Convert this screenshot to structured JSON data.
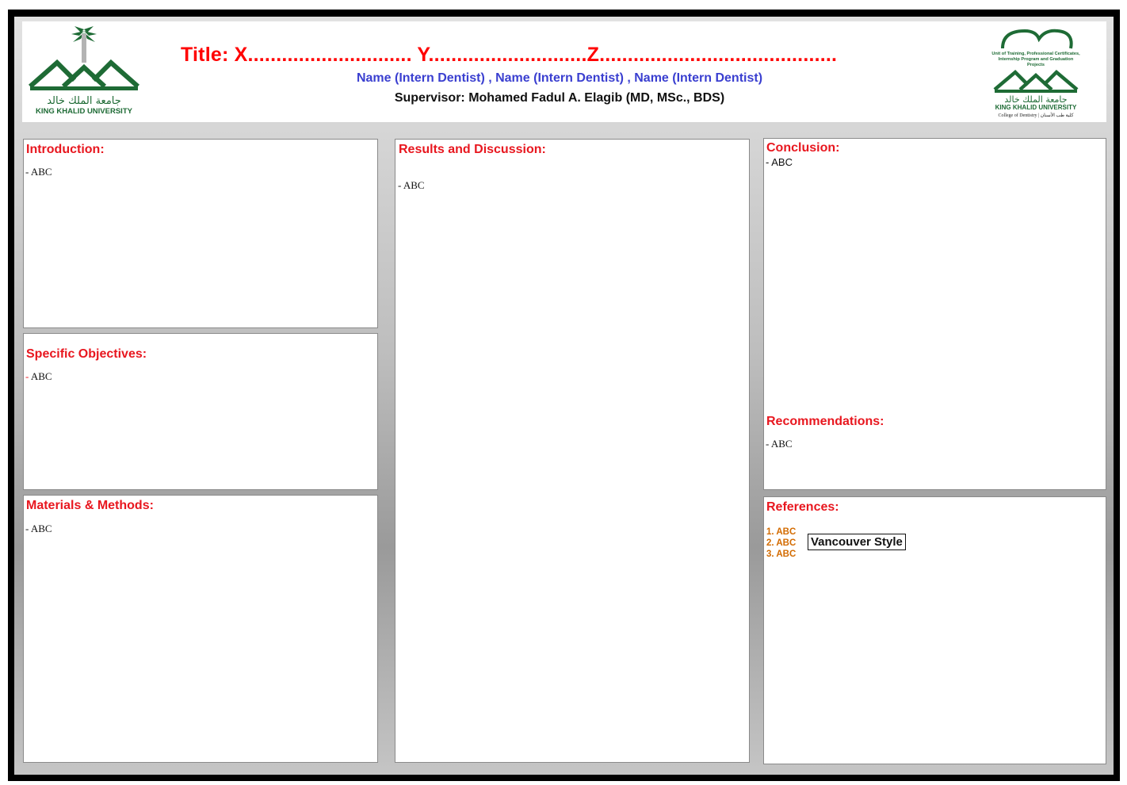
{
  "header": {
    "title": "Title: X............................. Y............................Z..........................................",
    "names": "Name (Intern Dentist) , Name (Intern Dentist) , Name (Intern Dentist)",
    "supervisor": "Supervisor: Mohamed Fadul A. Elagib (MD, MSc., BDS)",
    "logo_left": {
      "arabic": "جامعة الملك خالد",
      "english": "KING KHALID UNIVERSITY"
    },
    "logo_right": {
      "unit_line1": "Unit of Training, Professional Certificates,",
      "unit_line2": "Internship Program and Graduation",
      "unit_line3": "Projects",
      "arabic": "جامعة الملك خالد",
      "english": "KING KHALID UNIVERSITY",
      "college": "College of Dentistry | كلية طب الأسنان"
    }
  },
  "sections": {
    "introduction": {
      "heading": "Introduction:",
      "body": "- ABC"
    },
    "objectives": {
      "heading": "Specific Objectives:",
      "dash": "-",
      "body": " ABC"
    },
    "methods": {
      "heading": "Materials & Methods:",
      "body": "- ABC"
    },
    "results": {
      "heading": "Results and Discussion:",
      "body": "- ABC"
    },
    "conclusion": {
      "heading": "Conclusion:",
      "body": "- ABC"
    },
    "recommendations": {
      "heading": "Recommendations:",
      "body": "- ABC"
    },
    "references": {
      "heading": "References:",
      "items": [
        "1. ABC",
        "2. ABC",
        "3. ABC"
      ],
      "style_label": "Vancouver Style"
    }
  },
  "colors": {
    "heading_red": "#e8171f",
    "title_red": "#ff0000",
    "names_blue": "#3a3fd0",
    "reference_orange": "#d36b00",
    "kku_green": "#1e6b35"
  }
}
